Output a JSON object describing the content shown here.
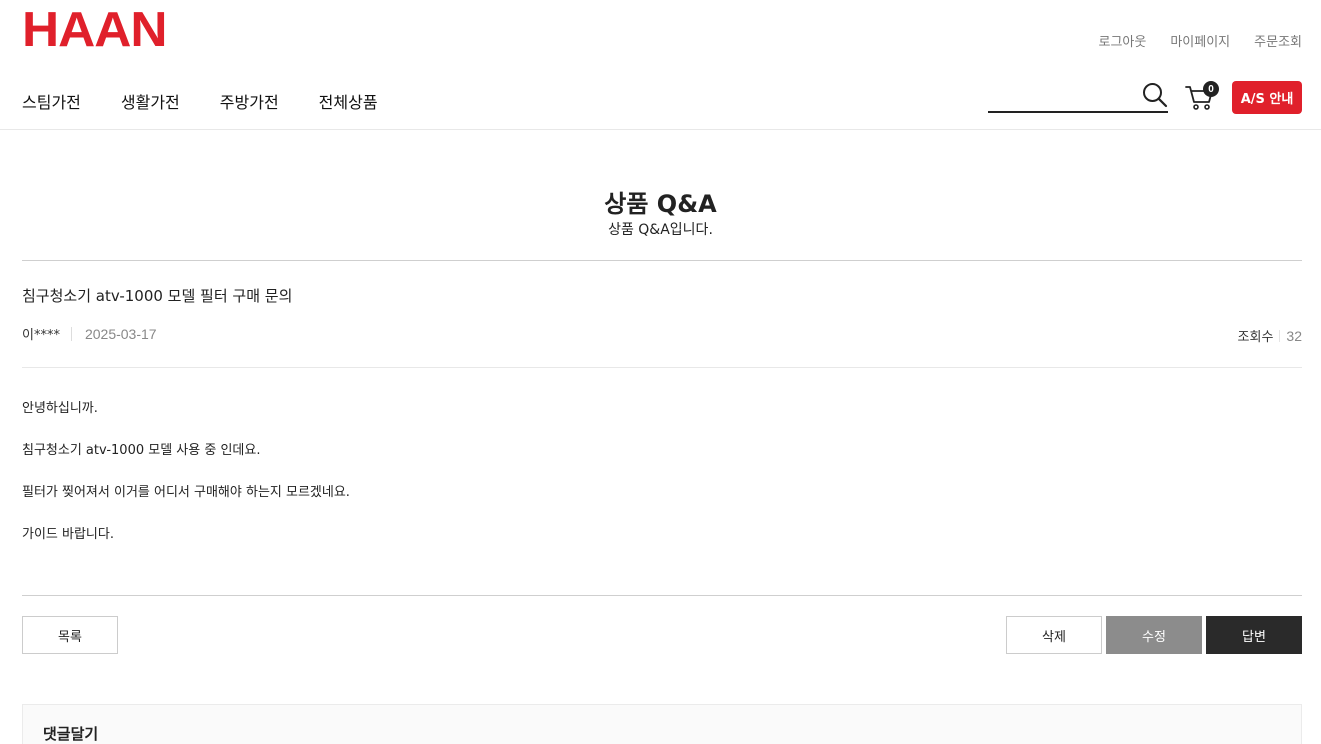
{
  "header": {
    "logo": "HAAN",
    "util_links": [
      "로그아웃",
      "마이페이지",
      "주문조회"
    ],
    "nav": [
      "스팀가전",
      "생활가전",
      "주방가전",
      "전체상품"
    ],
    "search": {
      "value": "",
      "placeholder": ""
    },
    "cart_count": "0",
    "as_button": "A/S 안내",
    "colors": {
      "brand": "#e0202b"
    }
  },
  "page": {
    "title": "상품 Q&A",
    "subtitle": "상품 Q&A입니다."
  },
  "post": {
    "title": "침구청소기 atv-1000 모델 필터 구매 문의",
    "author": "이****",
    "date": "2025-03-17",
    "views_label": "조회수",
    "views": "32",
    "body": [
      "안녕하십니까.",
      "침구청소기 atv-1000 모델 사용 중 인데요.",
      "필터가 찢어져서 이거를 어디서 구매해야 하는지 모르겠네요.",
      "가이드 바랍니다."
    ]
  },
  "buttons": {
    "list": "목록",
    "delete": "삭제",
    "edit": "수정",
    "reply": "답변"
  },
  "comment": {
    "title": "댓글달기"
  }
}
